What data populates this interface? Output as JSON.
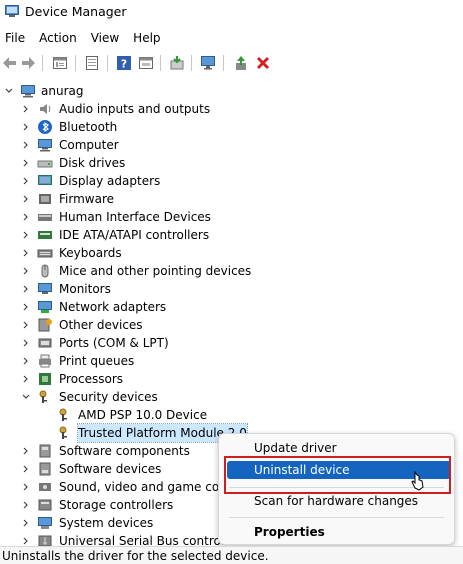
{
  "window": {
    "title": "Device Manager"
  },
  "menu": [
    "File",
    "Action",
    "View",
    "Help"
  ],
  "toolbar": {
    "buttons": [
      "back-icon",
      "forward-icon",
      "properties-icon",
      "show-hide-icon",
      "help-icon",
      "action-icon",
      "update-driver-icon",
      "monitor-icon",
      "enable-device-icon",
      "uninstall-red-x-icon"
    ]
  },
  "tree": {
    "root": "anurag",
    "categories": [
      {
        "label": "Audio inputs and outputs",
        "icon": "speaker-icon"
      },
      {
        "label": "Bluetooth",
        "icon": "bluetooth-icon"
      },
      {
        "label": "Computer",
        "icon": "computer-icon"
      },
      {
        "label": "Disk drives",
        "icon": "disk-drive-icon"
      },
      {
        "label": "Display adapters",
        "icon": "display-adapter-icon"
      },
      {
        "label": "Firmware",
        "icon": "firmware-icon"
      },
      {
        "label": "Human Interface Devices",
        "icon": "hid-icon"
      },
      {
        "label": "IDE ATA/ATAPI controllers",
        "icon": "ide-controller-icon"
      },
      {
        "label": "Keyboards",
        "icon": "keyboard-icon"
      },
      {
        "label": "Mice and other pointing devices",
        "icon": "mouse-icon"
      },
      {
        "label": "Monitors",
        "icon": "monitor-icon"
      },
      {
        "label": "Network adapters",
        "icon": "network-adapter-icon"
      },
      {
        "label": "Other devices",
        "icon": "other-devices-icon"
      },
      {
        "label": "Ports (COM & LPT)",
        "icon": "ports-icon"
      },
      {
        "label": "Print queues",
        "icon": "printer-icon"
      },
      {
        "label": "Processors",
        "icon": "processor-icon"
      },
      {
        "label": "Security devices",
        "icon": "security-key-icon"
      }
    ],
    "security_children": [
      "AMD PSP 10.0 Device",
      "Trusted Platform Module 2.0"
    ],
    "after_categories": [
      {
        "label": "Software components",
        "icon": "software-components-icon"
      },
      {
        "label": "Software devices",
        "icon": "software-devices-icon"
      },
      {
        "label": "Sound, video and game contr",
        "icon": "sound-icon"
      },
      {
        "label": "Storage controllers",
        "icon": "storage-icon"
      },
      {
        "label": "System devices",
        "icon": "system-devices-icon"
      },
      {
        "label": "Universal Serial Bus controllers",
        "icon": "usb-icon"
      }
    ]
  },
  "context_menu": {
    "items": [
      "Update driver",
      "Uninstall device",
      "Scan for hardware changes",
      "Properties"
    ]
  },
  "status": {
    "text": "Uninstalls the driver for the selected device."
  },
  "colors": {
    "highlight": "#1565c0",
    "callout_border": "#cc1f1f",
    "selection": "#cce8ff"
  }
}
